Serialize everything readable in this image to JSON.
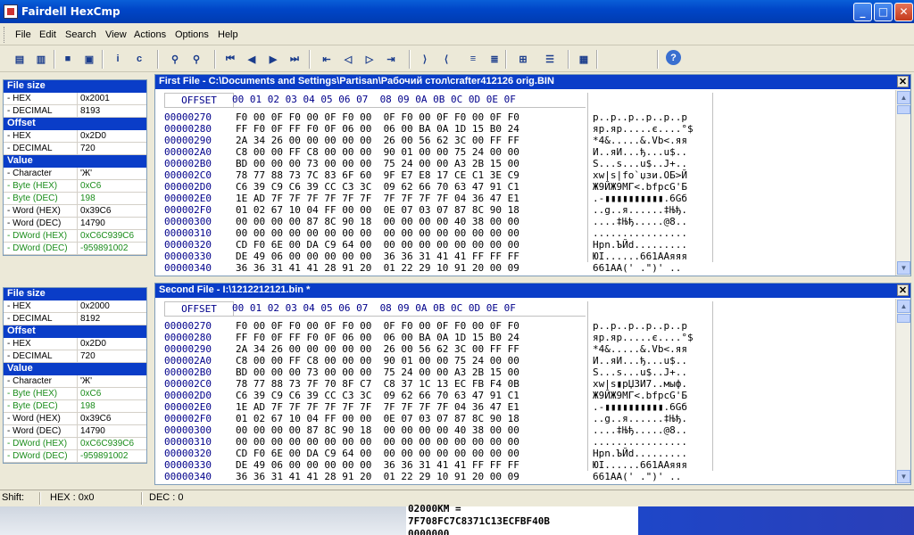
{
  "window": {
    "title": "Fairdell HexCmp"
  },
  "menu": [
    "File",
    "Edit",
    "Search",
    "View",
    "Actions",
    "Options",
    "Help"
  ],
  "toolbar_icons": [
    "open-file1-icon",
    "open-file2-icon",
    "save-icon",
    "save-all-icon",
    "info-icon",
    "compare-icon",
    "find-icon",
    "find-next-icon",
    "first-diff-icon",
    "prev-diff-icon",
    "next-diff-icon",
    "last-diff-icon",
    "first-block-icon",
    "prev-block-icon",
    "next-block-icon",
    "last-block-icon",
    "sync-left-icon",
    "sync-right-icon",
    "align-icon",
    "align2-icon",
    "split-icon",
    "list-icon",
    "report-icon",
    "help-icon"
  ],
  "info_panels": [
    {
      "file_size_label": "File size",
      "hex_label": "- HEX",
      "hex_value": "0x2001",
      "dec_label": "- DECIMAL",
      "dec_value": "8193",
      "offset_label": "Offset",
      "off_hex_label": "- HEX",
      "off_hex_value": "0x2D0",
      "off_dec_label": "- DECIMAL",
      "off_dec_value": "720",
      "value_label": "Value",
      "values": [
        {
          "k": "- Character",
          "v": "'Ж'",
          "green": false
        },
        {
          "k": "- Byte (HEX)",
          "v": "0xC6",
          "green": true
        },
        {
          "k": "- Byte (DEC)",
          "v": "198",
          "green": true
        },
        {
          "k": "- Word (HEX)",
          "v": "0x39C6",
          "green": false
        },
        {
          "k": "- Word (DEC)",
          "v": "14790",
          "green": false
        },
        {
          "k": "- DWord (HEX)",
          "v": "0xC6C939C6",
          "green": true
        },
        {
          "k": "- DWord (DEC)",
          "v": "-959891002",
          "green": true
        }
      ]
    },
    {
      "file_size_label": "File size",
      "hex_label": "- HEX",
      "hex_value": "0x2000",
      "dec_label": "- DECIMAL",
      "dec_value": "8192",
      "offset_label": "Offset",
      "off_hex_label": "- HEX",
      "off_hex_value": "0x2D0",
      "off_dec_label": "- DECIMAL",
      "off_dec_value": "720",
      "value_label": "Value",
      "values": [
        {
          "k": "- Character",
          "v": "'Ж'",
          "green": false
        },
        {
          "k": "- Byte (HEX)",
          "v": "0xC6",
          "green": true
        },
        {
          "k": "- Byte (DEC)",
          "v": "198",
          "green": true
        },
        {
          "k": "- Word (HEX)",
          "v": "0x39C6",
          "green": false
        },
        {
          "k": "- Word (DEC)",
          "v": "14790",
          "green": false
        },
        {
          "k": "- DWord (HEX)",
          "v": "0xC6C939C6",
          "green": true
        },
        {
          "k": "- DWord (DEC)",
          "v": "-959891002",
          "green": true
        }
      ]
    }
  ],
  "panels": [
    {
      "title": "First File - C:\\Documents and Settings\\Partisan\\Рабочий стол\\crafter412126 orig.BIN",
      "offset_header": "OFFSET",
      "hex_header": "00 01 02 03 04 05 06 07  08 09 0A 0B 0C 0D 0E 0F",
      "rows": [
        {
          "o": "00000270",
          "h": "F0 00 0F F0 00 0F F0 00  0F F0 00 0F F0 00 0F F0",
          "a": "p..p..p..p..p..p"
        },
        {
          "o": "00000280",
          "h": "FF F0 0F FF F0 0F 06 00  06 00 BA 0A 1D 15 B0 24",
          "a": "яр.яр.....є....°$"
        },
        {
          "o": "00000290",
          "h": "2A 34 26 00 00 00 00 00  26 00 56 62 3C 00 FF FF",
          "a": "*4&.....&.Vb<.яя"
        },
        {
          "o": "000002A0",
          "h": "C8 00 00 FF C8 00 00 00  90 01 00 00 75 24 00 00",
          "a": "И..яИ...ђ...u$.."
        },
        {
          "o": "000002B0",
          "h": "BD 00 00 00 73 00 00 00  75 24 00 00 A3 2B 15 00",
          "a": "S...s...u$..J+.."
        },
        {
          "o": "000002C0",
          "h": "78 77 88 73 7C 83 6F 60  9F E7 E8 17 CE C1 3E C9",
          "a": "xw|s|fo`џзи.ОБ>Й",
          "diff": true
        },
        {
          "o": "000002D0",
          "h": "C6 39 C9 C6 39 CC C3 3C  09 62 66 70 63 47 91 C1",
          "a": "Ж9ЙЖ9МГ<.bfpcG'Б",
          "sel": true
        },
        {
          "o": "000002E0",
          "h": "1E AD 7F 7F 7F 7F 7F 7F  7F 7F 7F 7F 04 36 47 E1",
          "a": ".-▮▮▮▮▮▮▮▮▮▮.6Gб"
        },
        {
          "o": "000002F0",
          "h": "01 02 67 10 04 FF 00 00  0E 07 03 07 87 8C 90 18",
          "a": "..g..я......‡Њђ."
        },
        {
          "o": "00000300",
          "h": "00 00 00 00 87 8C 90 18  00 00 00 00 40 38 00 00",
          "a": "....‡Њђ.....@8.."
        },
        {
          "o": "00000310",
          "h": "00 00 00 00 00 00 00 00  00 00 00 00 00 00 00 00",
          "a": "................"
        },
        {
          "o": "00000320",
          "h": "CD F0 6E 00 DA C9 64 00  00 00 00 00 00 00 00 00",
          "a": "Нрn.ЪЙd........."
        },
        {
          "o": "00000330",
          "h": "DE 49 06 00 00 00 00 00  36 36 31 41 41 FF FF FF",
          "a": "ЮI......661AAяяя"
        },
        {
          "o": "00000340",
          "h": "36 36 31 41 41 28 91 20  01 22 29 10 91 20 00 09",
          "a": "661AA(' .\")' .."
        }
      ]
    },
    {
      "title": "Second File - I:\\1212212121.bin *",
      "offset_header": "OFFSET",
      "hex_header": "00 01 02 03 04 05 06 07  08 09 0A 0B 0C 0D 0E 0F",
      "rows": [
        {
          "o": "00000270",
          "h": "F0 00 0F F0 00 0F F0 00  0F F0 00 0F F0 00 0F F0",
          "a": "p..p..p..p..p..p"
        },
        {
          "o": "00000280",
          "h": "FF F0 0F FF F0 0F 06 00  06 00 BA 0A 1D 15 B0 24",
          "a": "яр.яр.....є....°$"
        },
        {
          "o": "00000290",
          "h": "2A 34 26 00 00 00 00 00  26 00 56 62 3C 00 FF FF",
          "a": "*4&.....&.Vb<.яя"
        },
        {
          "o": "000002A0",
          "h": "C8 00 00 FF C8 00 00 00  90 01 00 00 75 24 00 00",
          "a": "И..яИ...ђ...u$.."
        },
        {
          "o": "000002B0",
          "h": "BD 00 00 00 73 00 00 00  75 24 00 00 A3 2B 15 00",
          "a": "S...s...u$..J+.."
        },
        {
          "o": "000002C0",
          "h": "78 77 88 73 7F 70 8F C7  C8 37 1C 13 EC FB F4 0B",
          "a": "xw|s▮pЏЗИ7..мыф.",
          "diff": true
        },
        {
          "o": "000002D0",
          "h": "C6 39 C9 C6 39 CC C3 3C  09 62 66 70 63 47 91 C1",
          "a": "Ж9ЙЖ9МГ<.bfpcG'Б",
          "sel": true
        },
        {
          "o": "000002E0",
          "h": "1E AD 7F 7F 7F 7F 7F 7F  7F 7F 7F 7F 04 36 47 E1",
          "a": ".-▮▮▮▮▮▮▮▮▮▮.6Gб"
        },
        {
          "o": "000002F0",
          "h": "01 02 67 10 04 FF 00 00  0E 07 03 07 87 8C 90 18",
          "a": "..g..я......‡Њђ."
        },
        {
          "o": "00000300",
          "h": "00 00 00 00 87 8C 90 18  00 00 00 00 40 38 00 00",
          "a": "....‡Њђ.....@8.."
        },
        {
          "o": "00000310",
          "h": "00 00 00 00 00 00 00 00  00 00 00 00 00 00 00 00",
          "a": "................"
        },
        {
          "o": "00000320",
          "h": "CD F0 6E 00 DA C9 64 00  00 00 00 00 00 00 00 00",
          "a": "Нрn.ЪЙd........."
        },
        {
          "o": "00000330",
          "h": "DE 49 06 00 00 00 00 00  36 36 31 41 41 FF FF FF",
          "a": "ЮI......661AAяяя"
        },
        {
          "o": "00000340",
          "h": "36 36 31 41 41 28 91 20  01 22 29 10 91 20 00 09",
          "a": "661AA(' .\")' .."
        }
      ]
    }
  ],
  "status": {
    "shift": "Shift:",
    "hex": "HEX : 0x0",
    "dec": "DEC : 0"
  },
  "taskbar_text": {
    "line1": "02000KM =",
    "line2": "7F708FC7C8371C13ECFBF40B",
    "line3": "0000000"
  }
}
